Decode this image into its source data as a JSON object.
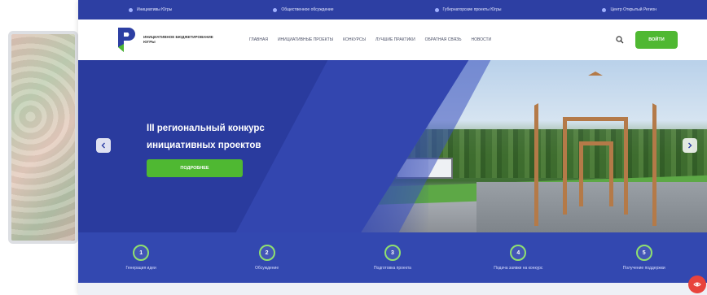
{
  "topbar": {
    "items": [
      {
        "label": "Инициативы Югры"
      },
      {
        "label": "Общественное обсуждение"
      },
      {
        "label": "Губернаторские проекты Югры"
      },
      {
        "label": "Центр Открытый Регион"
      }
    ]
  },
  "header": {
    "brand": "Инициативное бюджетирование Югры",
    "nav": [
      {
        "label": "Главная"
      },
      {
        "label": "Инициативные проекты"
      },
      {
        "label": "Конкурсы"
      },
      {
        "label": "Лучшие практики"
      },
      {
        "label": "Обратная связь"
      },
      {
        "label": "Новости"
      }
    ],
    "login_label": "Войти"
  },
  "hero": {
    "title_line1": "III региональный конкурс",
    "title_line2": "инициативных проектов",
    "cta_label": "Подробнее"
  },
  "steps": [
    {
      "number": "1",
      "label": "Генерация идеи"
    },
    {
      "number": "2",
      "label": "Обсуждение"
    },
    {
      "number": "3",
      "label": "Подготовка проекта"
    },
    {
      "number": "4",
      "label": "Подача заявки на конкурс"
    },
    {
      "number": "5",
      "label": "Получение поддержки"
    }
  ],
  "colors": {
    "primary": "#2d3fa3",
    "accent": "#4fb832",
    "fab": "#e8433c"
  }
}
